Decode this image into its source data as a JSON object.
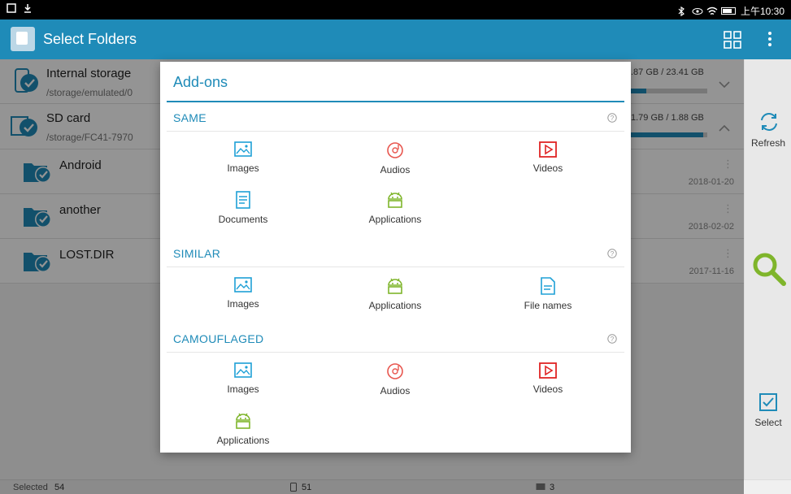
{
  "status_bar": {
    "time": "上午10:30"
  },
  "app_bar": {
    "title": "Select Folders"
  },
  "storage": [
    {
      "name": "Internal storage",
      "path": "/storage/emulated/0",
      "usage": ".87 GB / 23.41 GB",
      "fill_fraction": 0.2
    },
    {
      "name": "SD card",
      "path": "/storage/FC41-7970",
      "usage": "1.79 GB / 1.88 GB",
      "fill_fraction": 0.95
    }
  ],
  "folders": [
    {
      "name": "Android",
      "date": "2018-01-20"
    },
    {
      "name": "another",
      "date": "2018-02-02"
    },
    {
      "name": "LOST.DIR",
      "date": "2017-11-16"
    }
  ],
  "side": {
    "refresh_label": "Refresh",
    "select_label": "Select"
  },
  "bottom": {
    "selected_label": "Selected",
    "selected_count": "54",
    "phone_count": "51",
    "sd_count": "3"
  },
  "dialog": {
    "title": "Add-ons",
    "sections": [
      {
        "name": "SAME",
        "items": [
          "Images",
          "Audios",
          "Videos",
          "Documents",
          "Applications"
        ]
      },
      {
        "name": "SIMILAR",
        "items": [
          "Images",
          "Applications",
          "File names"
        ]
      },
      {
        "name": "CAMOUFLAGED",
        "items": [
          "Images",
          "Audios",
          "Videos",
          "Applications"
        ]
      }
    ]
  },
  "colors": {
    "accent": "#1f8bb8",
    "image": "#1ea0d6",
    "audio": "#e8574f",
    "video": "#e02424",
    "document": "#1ea0d6",
    "app": "#7fb52b"
  }
}
